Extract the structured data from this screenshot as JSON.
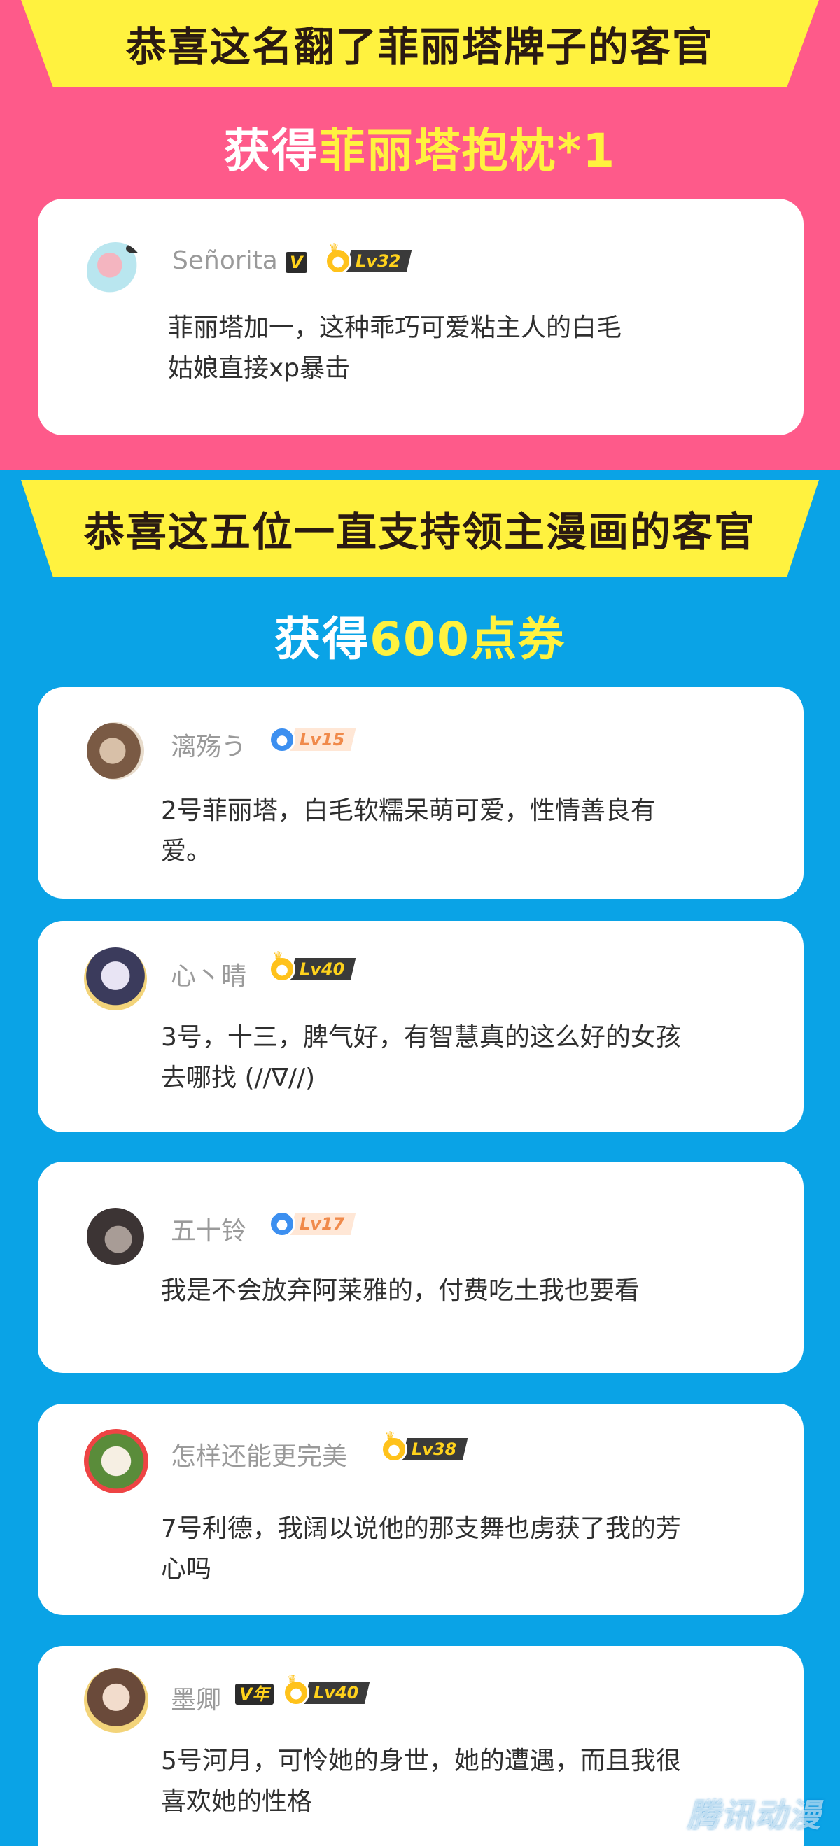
{
  "section1": {
    "banner": "恭喜这名翻了菲丽塔牌子的客官",
    "prize_prefix": "获得",
    "prize": "菲丽塔抱枕*1",
    "winner": {
      "username": "Señorita",
      "vip_badge": "V",
      "level": "Lv32",
      "comment_line1": "菲丽塔加一，这种乖巧可爱粘主人的白毛",
      "comment_line2": "姑娘直接xp暴击"
    }
  },
  "section2": {
    "banner": "恭喜这五位一直支持领主漫画的客官",
    "prize_prefix": "获得",
    "prize": "600点券",
    "winners": [
      {
        "username": "漓殇う",
        "level": "Lv15",
        "comment_line1": "2号菲丽塔，白毛软糯呆萌可爱，性情善良有",
        "comment_line2": "爱。"
      },
      {
        "username": "心丶晴",
        "level": "Lv40",
        "comment_line1": "3号，十三，脾气好，有智慧真的这么好的女孩",
        "comment_line2": "去哪找 (//∇//)"
      },
      {
        "username": "五十铃",
        "level": "Lv17",
        "comment_line1": "我是不会放弃阿莱雅的，付费吃土我也要看",
        "comment_line2": ""
      },
      {
        "username": "怎样还能更完美",
        "level": "Lv38",
        "comment_line1": "7号利德，我阔以说他的那支舞也虏获了我的芳",
        "comment_line2": "心吗"
      },
      {
        "username": "墨卿",
        "vip_badge": "V年",
        "level": "Lv40",
        "comment_line1": "5号河月，可怜她的身世，她的遭遇，而且我很",
        "comment_line2": "喜欢她的性格"
      }
    ]
  },
  "watermark": "腾讯动漫",
  "colors": {
    "pink_bg": "#fe5a8a",
    "blue_bg": "#0aa3e6",
    "banner_yellow": "#fff23f",
    "prize_yellow": "#fff23f"
  }
}
